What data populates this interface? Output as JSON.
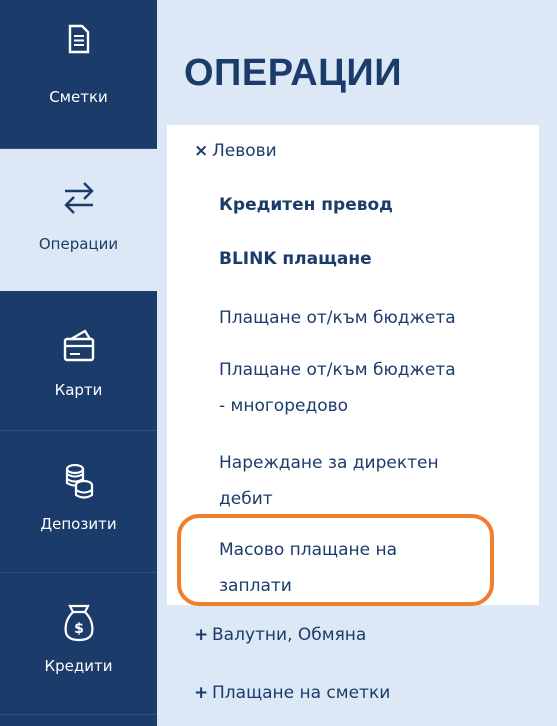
{
  "nav": {
    "items": [
      {
        "label": "Сметки",
        "icon": "document-icon",
        "active": false
      },
      {
        "label": "Операции",
        "icon": "transfer-arrows-icon",
        "active": true
      },
      {
        "label": "Карти",
        "icon": "card-icon",
        "active": false
      },
      {
        "label": "Депозити",
        "icon": "coins-icon",
        "active": false
      },
      {
        "label": "Кредити",
        "icon": "money-bag-icon",
        "active": false
      }
    ]
  },
  "panel": {
    "title": "ОПЕРАЦИИ",
    "groups": [
      {
        "symbol": "×",
        "label": "Левови",
        "expanded": true,
        "items": [
          {
            "label_lines": [
              "Кредитен превод"
            ]
          },
          {
            "label_lines": [
              "BLINK плащане"
            ]
          },
          {
            "label_lines": [
              "Плащане от/към бюджета"
            ]
          },
          {
            "label_lines": [
              "Плащане от/към бюджета",
              "- многоредово"
            ]
          },
          {
            "label_lines": [
              "Нареждане за директен",
              "дебит"
            ]
          },
          {
            "label_lines": [
              "Масово плащане на",
              "заплати"
            ],
            "highlighted": true
          }
        ]
      },
      {
        "symbol": "+",
        "label": "Валутни, Обмяна",
        "expanded": false
      },
      {
        "symbol": "+",
        "label": "Плащане на сметки",
        "expanded": false
      }
    ]
  },
  "colors": {
    "navy": "#1b3c6b",
    "light_blue": "#dce8f5",
    "highlight": "#f07f2c"
  }
}
